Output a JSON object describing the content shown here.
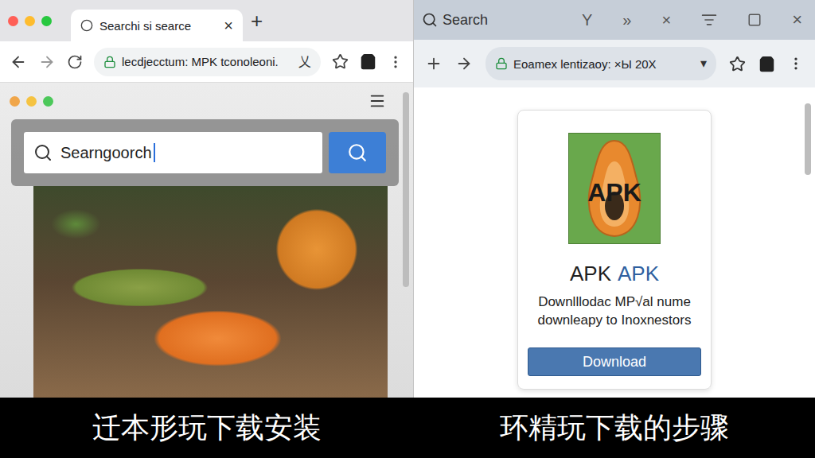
{
  "left_window": {
    "window_controls": [
      {
        "color": "#ff5f57"
      },
      {
        "color": "#febc2e"
      },
      {
        "color": "#28c840"
      }
    ],
    "tab": {
      "label": "Searchi si searce",
      "close": "×",
      "selected": true
    },
    "new_tab": "+",
    "address": {
      "text": "lecdjecctum: MPK tconoleoni.",
      "trailing": "乂"
    },
    "inner_window_controls": [
      {
        "color": "#f0a64a"
      },
      {
        "color": "#f5c342"
      },
      {
        "color": "#4cc85a"
      }
    ],
    "search": {
      "value": "Searngoorch"
    }
  },
  "right_window": {
    "header": {
      "label": "Search",
      "glyphs": [
        "Y",
        "»",
        "×"
      ],
      "close": "×"
    },
    "address": {
      "text": "Eoamex lentizaoy: ×Ы 20X",
      "dropdown": "▾"
    },
    "card": {
      "icon_text": "APK",
      "title": [
        {
          "text": "APK",
          "color": "#1f1f1f"
        },
        {
          "text": "APK",
          "color": "#2f5f9f"
        }
      ],
      "description": [
        "Downlllodac MP√al nume",
        "downleapy to Inoxnestors"
      ],
      "button": "Download"
    }
  },
  "captions": [
    "迁本形玩下载安装",
    "环精玩下载的步骤"
  ]
}
